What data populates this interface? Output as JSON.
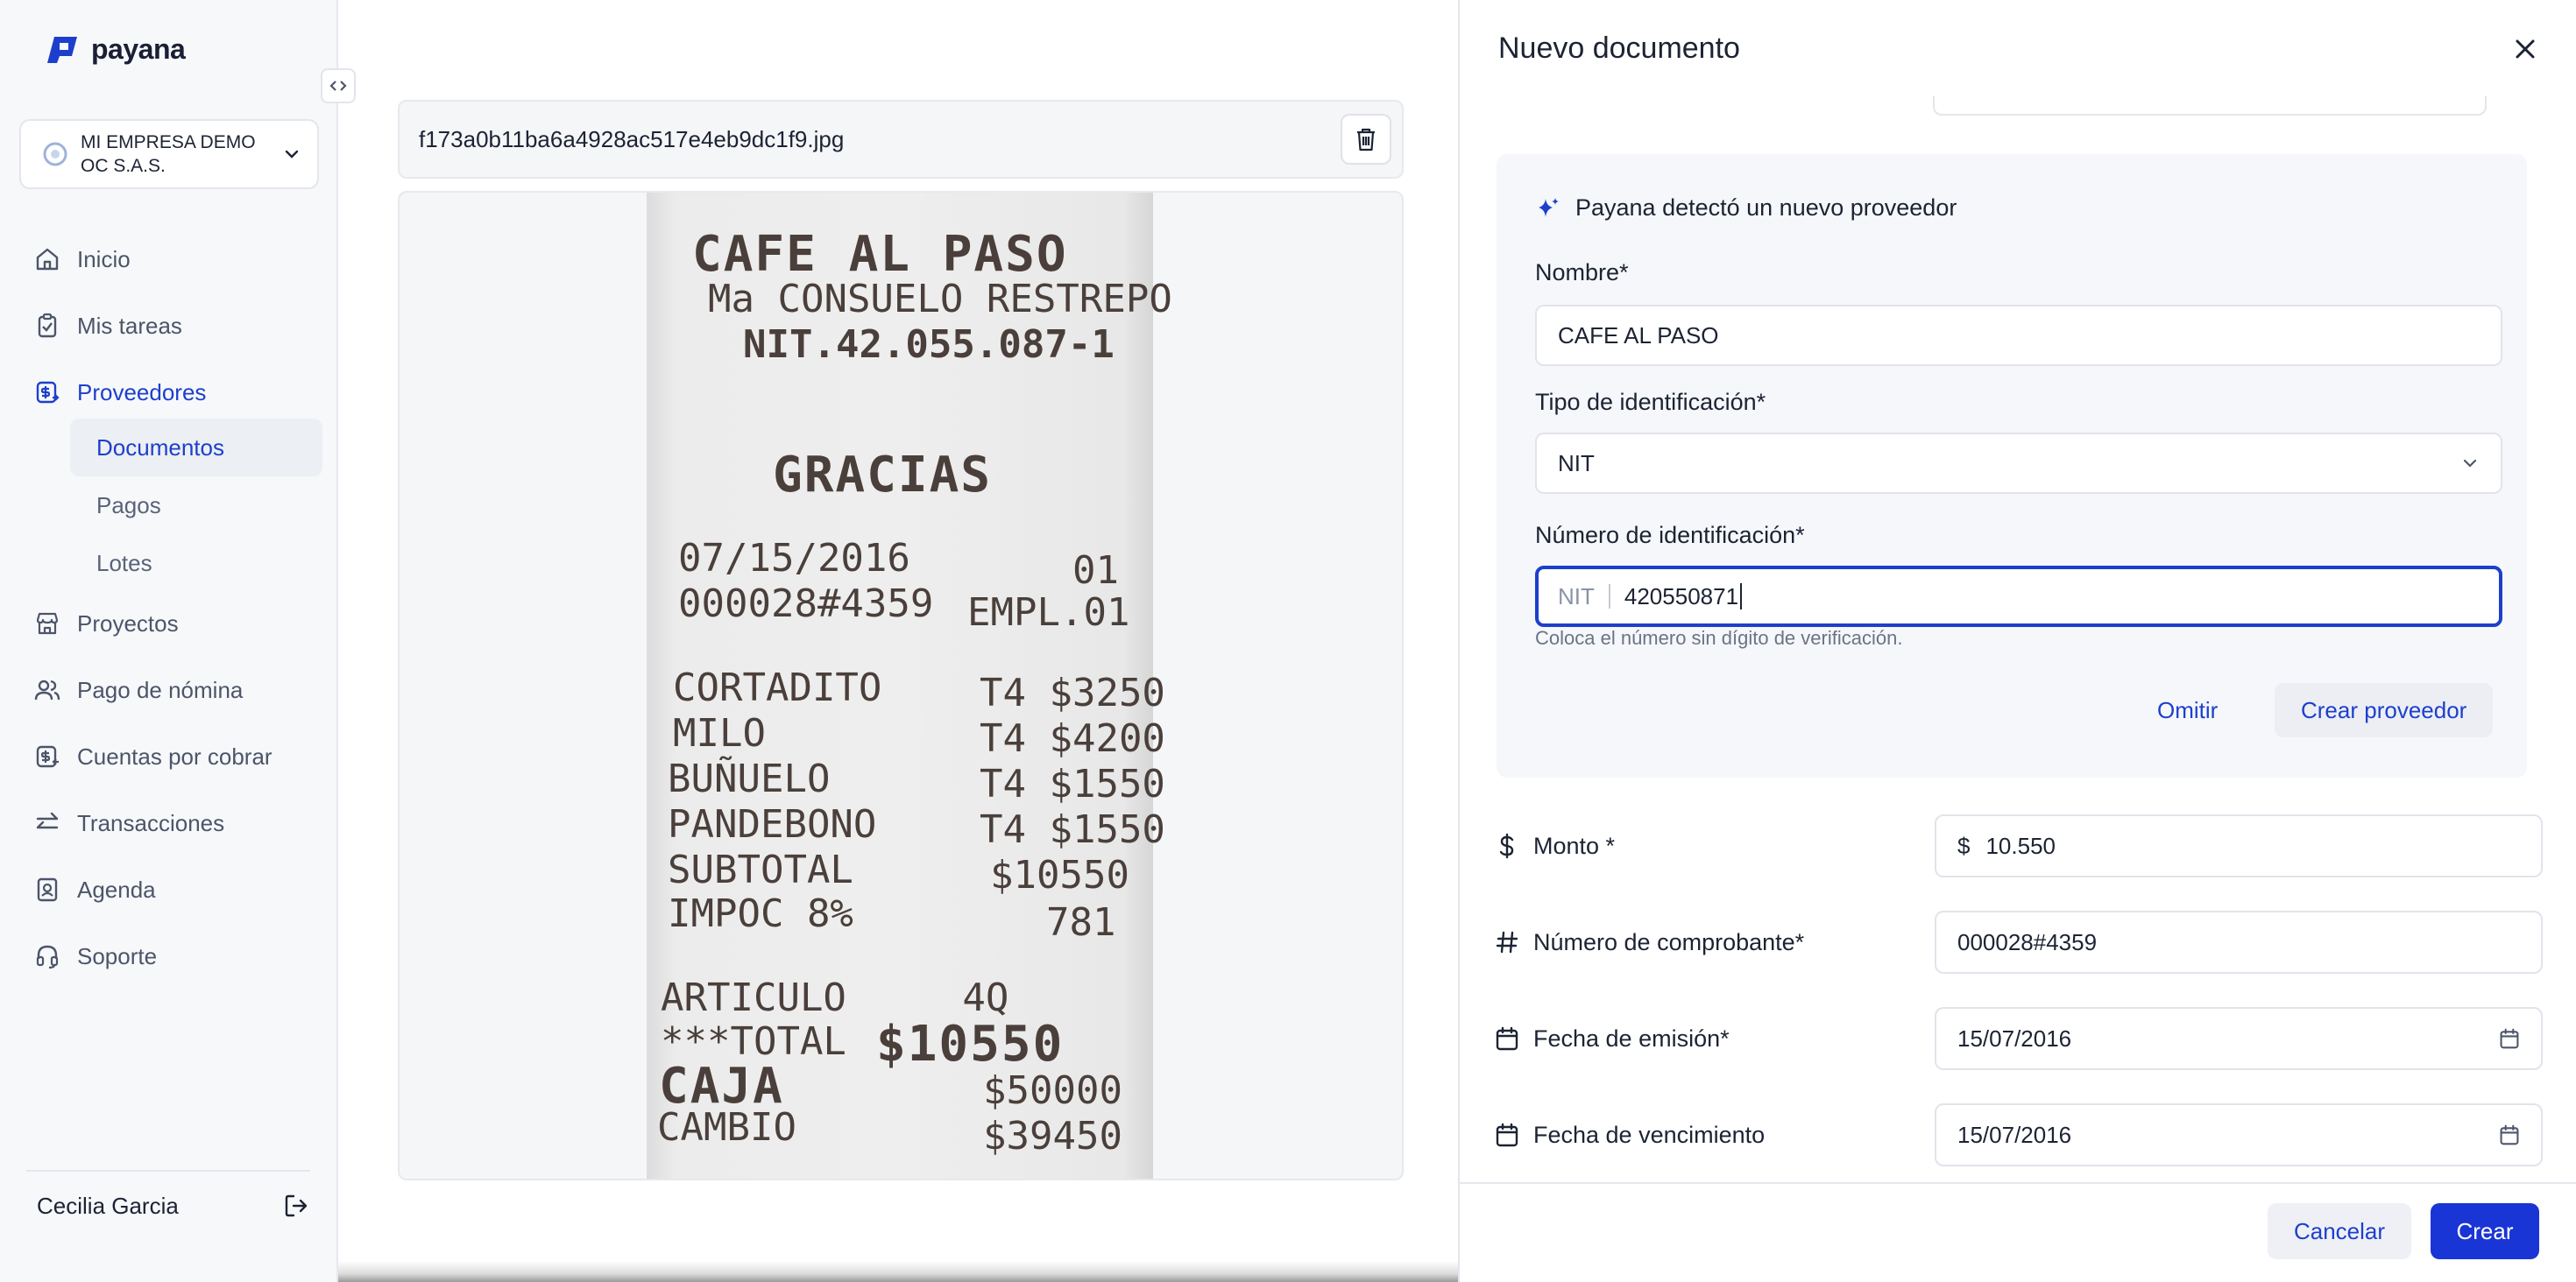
{
  "app": {
    "brand": "payana"
  },
  "sidebar": {
    "company": "MI EMPRESA DEMO OC S.A.S.",
    "items": [
      {
        "label": "Inicio",
        "icon": "home-icon"
      },
      {
        "label": "Mis tareas",
        "icon": "clipboard-icon"
      },
      {
        "label": "Proveedores",
        "icon": "provider-icon",
        "active": true
      },
      {
        "label": "Proyectos",
        "icon": "store-icon"
      },
      {
        "label": "Pago de nómina",
        "icon": "users-icon"
      },
      {
        "label": "Cuentas por cobrar",
        "icon": "receivable-icon"
      },
      {
        "label": "Transacciones",
        "icon": "transfer-icon"
      },
      {
        "label": "Agenda",
        "icon": "contact-book-icon"
      },
      {
        "label": "Soporte",
        "icon": "headset-icon"
      }
    ],
    "subitems": [
      {
        "label": "Documentos",
        "active": true
      },
      {
        "label": "Pagos"
      },
      {
        "label": "Lotes"
      }
    ],
    "user": "Cecilia Garcia"
  },
  "document": {
    "file_name": "f173a0b11ba6a4928ac517e4eb9dc1f9.jpg",
    "receipt": {
      "header1": "CAFE AL PASO",
      "header2": "Ma CONSUELO RESTREPO",
      "header3": "NIT.42.055.087-1",
      "thanks": "GRACIAS",
      "date": "07/15/2016",
      "date_right": "01",
      "ticket": "000028#4359",
      "ticket_right": "EMPL.01",
      "lines": [
        {
          "name": "CORTADITO",
          "amount": "T4 $3250"
        },
        {
          "name": "MILO",
          "amount": "T4 $4200"
        },
        {
          "name": "BUÑUELO",
          "amount": "T4 $1550"
        },
        {
          "name": "PANDEBONO",
          "amount": "T4 $1550"
        },
        {
          "name": "SUBTOTAL",
          "amount": "$10550"
        },
        {
          "name": "IMPOC 8%",
          "amount": "781"
        }
      ],
      "articulo": "ARTICULO     4Q",
      "total_label": "***TOTAL",
      "total_value": "$10550",
      "caja_label": "CAJA",
      "caja_value": "$50000",
      "cambio_label": "CAMBIO",
      "cambio_value": "$39450"
    }
  },
  "panel": {
    "title": "Nuevo documento",
    "detect": {
      "heading": "Payana detectó un nuevo proveedor",
      "name_label": "Nombre*",
      "name_value": "CAFE AL PASO",
      "id_type_label": "Tipo de identificación*",
      "id_type_value": "NIT",
      "id_number_label": "Número de identificación*",
      "id_prefix": "NIT",
      "id_number_value": "420550871",
      "helper": "Coloca el número sin dígito de verificación.",
      "skip_label": "Omitir",
      "create_label": "Crear proveedor"
    },
    "fields": {
      "amount_label": "Monto *",
      "amount_currency": "$",
      "amount_value": "10.550",
      "receipt_label": "Número de comprobante*",
      "receipt_value": "000028#4359",
      "issue_label": "Fecha de emisión*",
      "issue_value": "15/07/2016",
      "due_label": "Fecha de vencimiento",
      "due_value": "15/07/2016"
    },
    "footer": {
      "cancel_label": "Cancelar",
      "create_label": "Crear"
    }
  },
  "colors": {
    "accent": "#1d3fcc",
    "primary_button": "#1935d6"
  }
}
